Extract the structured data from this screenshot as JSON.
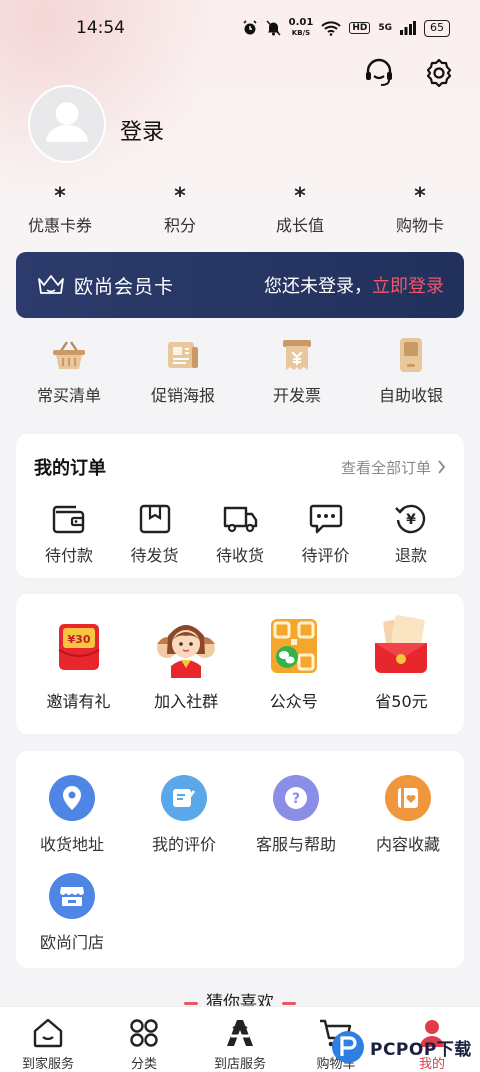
{
  "status_bar": {
    "time": "14:54",
    "net_speed_value": "0.01",
    "net_speed_unit": "KB/S",
    "hd": "HD",
    "signal": "5G",
    "battery": "65"
  },
  "header": {
    "icons": [
      "customer-service-icon",
      "settings-icon"
    ]
  },
  "profile": {
    "login_label": "登录",
    "stats": [
      {
        "value": "*",
        "label": "优惠卡券"
      },
      {
        "value": "*",
        "label": "积分"
      },
      {
        "value": "*",
        "label": "成长值"
      },
      {
        "value": "*",
        "label": "购物卡"
      }
    ]
  },
  "member_card": {
    "title": "欧尚会员卡",
    "prompt": "您还未登录，",
    "link": "立即登录",
    "link_color": "#f0576a"
  },
  "tools": [
    {
      "label": "常买清单",
      "icon": "basket-icon"
    },
    {
      "label": "促销海报",
      "icon": "poster-icon"
    },
    {
      "label": "开发票",
      "icon": "invoice-icon"
    },
    {
      "label": "自助收银",
      "icon": "self-checkout-icon"
    }
  ],
  "orders": {
    "title": "我的订单",
    "view_all": "查看全部订单",
    "items": [
      {
        "label": "待付款",
        "icon": "wallet-icon"
      },
      {
        "label": "待发货",
        "icon": "box-icon"
      },
      {
        "label": "待收货",
        "icon": "truck-icon"
      },
      {
        "label": "待评价",
        "icon": "comment-icon"
      },
      {
        "label": "退款",
        "icon": "refund-icon"
      }
    ]
  },
  "promos": [
    {
      "label": "邀请有礼",
      "badge": "¥30",
      "icon": "red-packet-icon"
    },
    {
      "label": "加入社群",
      "icon": "community-icon"
    },
    {
      "label": "公众号",
      "icon": "wechat-qr-icon"
    },
    {
      "label": "省50元",
      "icon": "coupon-envelope-icon"
    }
  ],
  "services": [
    {
      "label": "收货地址",
      "icon": "location-icon",
      "color": "#4f86e6"
    },
    {
      "label": "我的评价",
      "icon": "edit-icon",
      "color": "#5aa8ea"
    },
    {
      "label": "客服与帮助",
      "icon": "help-icon",
      "color": "#8a8ee6"
    },
    {
      "label": "内容收藏",
      "icon": "favorite-icon",
      "color": "#f0973e"
    },
    {
      "label": "欧尚门店",
      "icon": "store-icon",
      "color": "#4f86e6"
    }
  ],
  "guess_title": "猜你喜欢",
  "bottom_nav": [
    {
      "label": "到家服务",
      "icon": "home-icon"
    },
    {
      "label": "分类",
      "icon": "category-icon"
    },
    {
      "label": "到店服务",
      "icon": "store-logo-icon"
    },
    {
      "label": "购物车",
      "icon": "cart-icon"
    },
    {
      "label": "我的",
      "icon": "profile-icon",
      "active": true
    }
  ],
  "watermark": "PCPOP下载"
}
